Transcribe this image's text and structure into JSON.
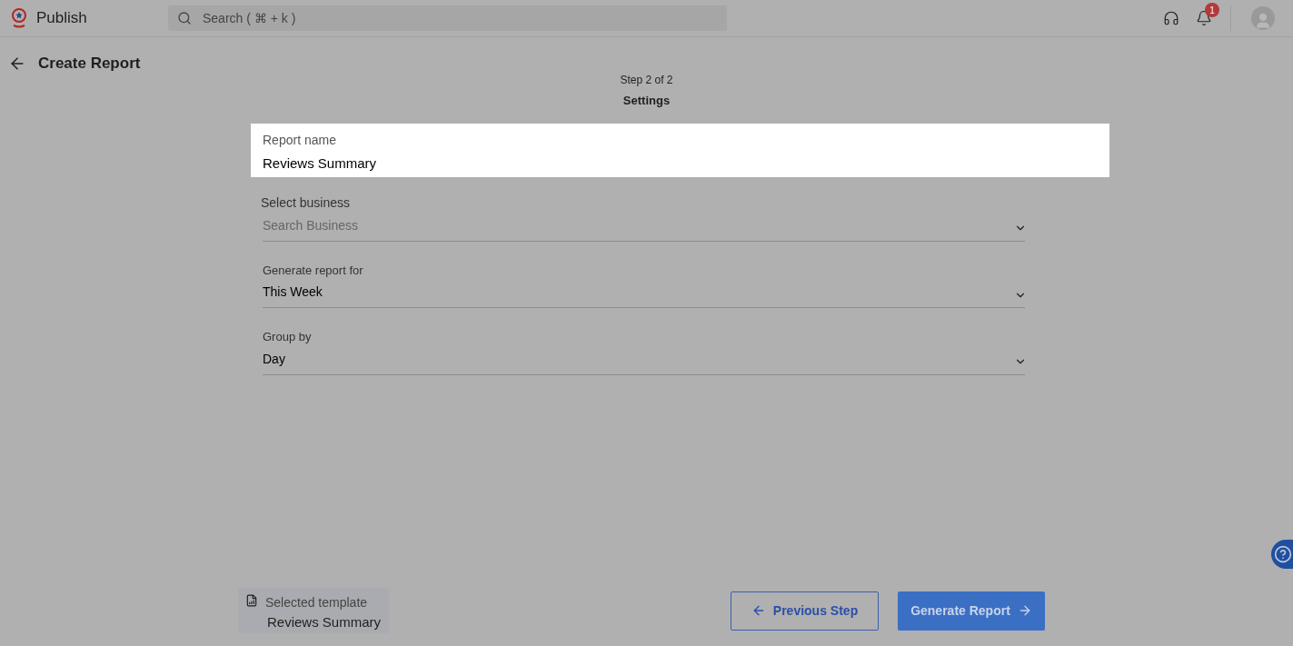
{
  "header": {
    "app_name": "Publish",
    "search": {
      "placeholder": "Search ( ⌘ + k )"
    },
    "notifications": {
      "count": "1"
    }
  },
  "page": {
    "title": "Create Report",
    "step": "Step 2 of 2",
    "step_title": "Settings"
  },
  "form": {
    "report_name": {
      "label": "Report name",
      "value": "Reviews Summary"
    },
    "fields": [
      {
        "label": "Select business",
        "placeholder": "Search Business"
      },
      {
        "label": "Generate report for",
        "value": "This Week"
      },
      {
        "label": "Group by",
        "value": "Day"
      }
    ]
  },
  "footer": {
    "template_label": "Selected template",
    "template_name": "Reviews Summary",
    "previous_button": "Previous Step",
    "generate_button": "Generate Report"
  }
}
